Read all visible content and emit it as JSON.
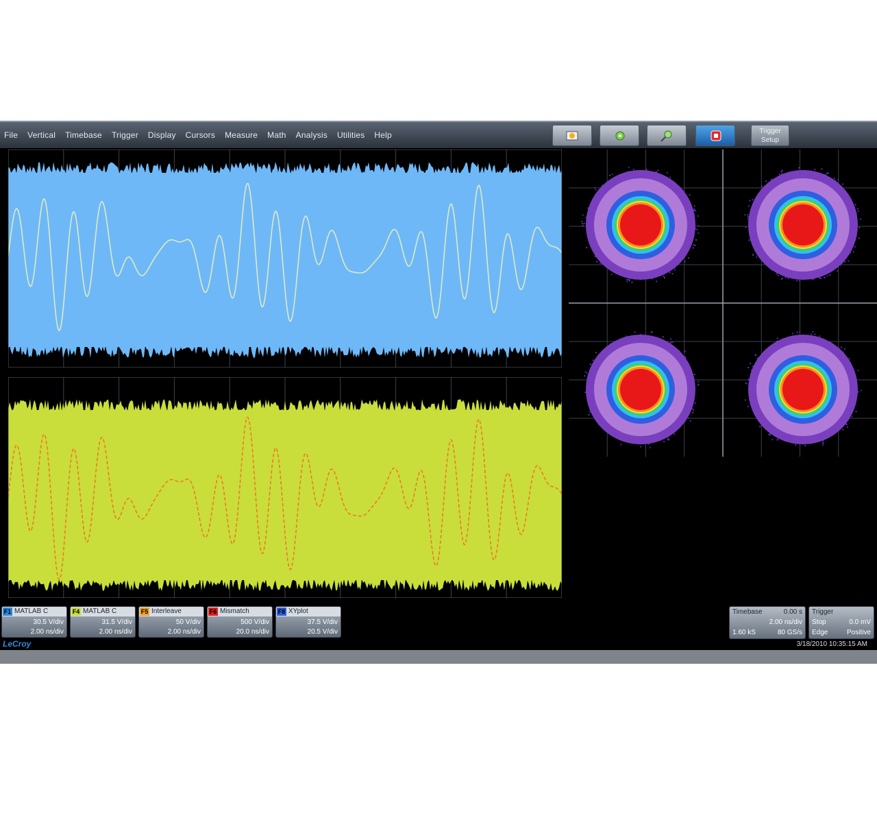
{
  "menu": [
    "File",
    "Vertical",
    "Timebase",
    "Trigger",
    "Display",
    "Cursors",
    "Measure",
    "Math",
    "Analysis",
    "Utilities",
    "Help"
  ],
  "toolbar": {
    "buttons": [
      {
        "icon": "auto-setup-icon"
      },
      {
        "icon": "measure-icon"
      },
      {
        "icon": "zoom-icon"
      },
      {
        "icon": "trigger-mode-icon"
      }
    ],
    "trigger_setup_line1": "Trigger",
    "trigger_setup_line2": "Setup"
  },
  "colors": {
    "trace_blue": "#6fb8f7",
    "trace_yellow": "#c9de3b",
    "accent": "#2f8ae0",
    "constellation": [
      "#7a3fbf",
      "#b07bd8",
      "#2f5fe0",
      "#30c0f0",
      "#3ad070",
      "#f0e030",
      "#ff8a20",
      "#e81818"
    ]
  },
  "descriptors": [
    {
      "tag": "F1",
      "name": "MATLAB C",
      "line1": "30.5 V/div",
      "line2": "2.00 ns/div",
      "color": "#2f8ae0"
    },
    {
      "tag": "F4",
      "name": "MATLAB C",
      "line1": "31.5 V/div",
      "line2": "2.00 ns/div",
      "color": "#c9de3b"
    },
    {
      "tag": "F5",
      "name": "Interleave",
      "line1": "50 V/div",
      "line2": "2.00 ns/div",
      "color": "#f0a030"
    },
    {
      "tag": "F6",
      "name": "Mismatch",
      "line1": "500 V/div",
      "line2": "20.0 ns/div",
      "color": "#e02020"
    },
    {
      "tag": "F8",
      "name": "XYplot",
      "line1": "37.5 V/div",
      "line2": "20.5 V/div",
      "color": "#2f5fe0"
    }
  ],
  "timebase": {
    "label": "Timebase",
    "value1": "0.00 s",
    "value2": "2.00 ns/div",
    "value3": "1.60 kS",
    "value4": "80 GS/s"
  },
  "trigger": {
    "label": "Trigger",
    "mode": "Stop",
    "type": "Edge",
    "level": "0.0 mV",
    "slope": "Positive"
  },
  "status": {
    "logo": "LeCroy",
    "datetime": "3/18/2010 10:35:15 AM"
  }
}
